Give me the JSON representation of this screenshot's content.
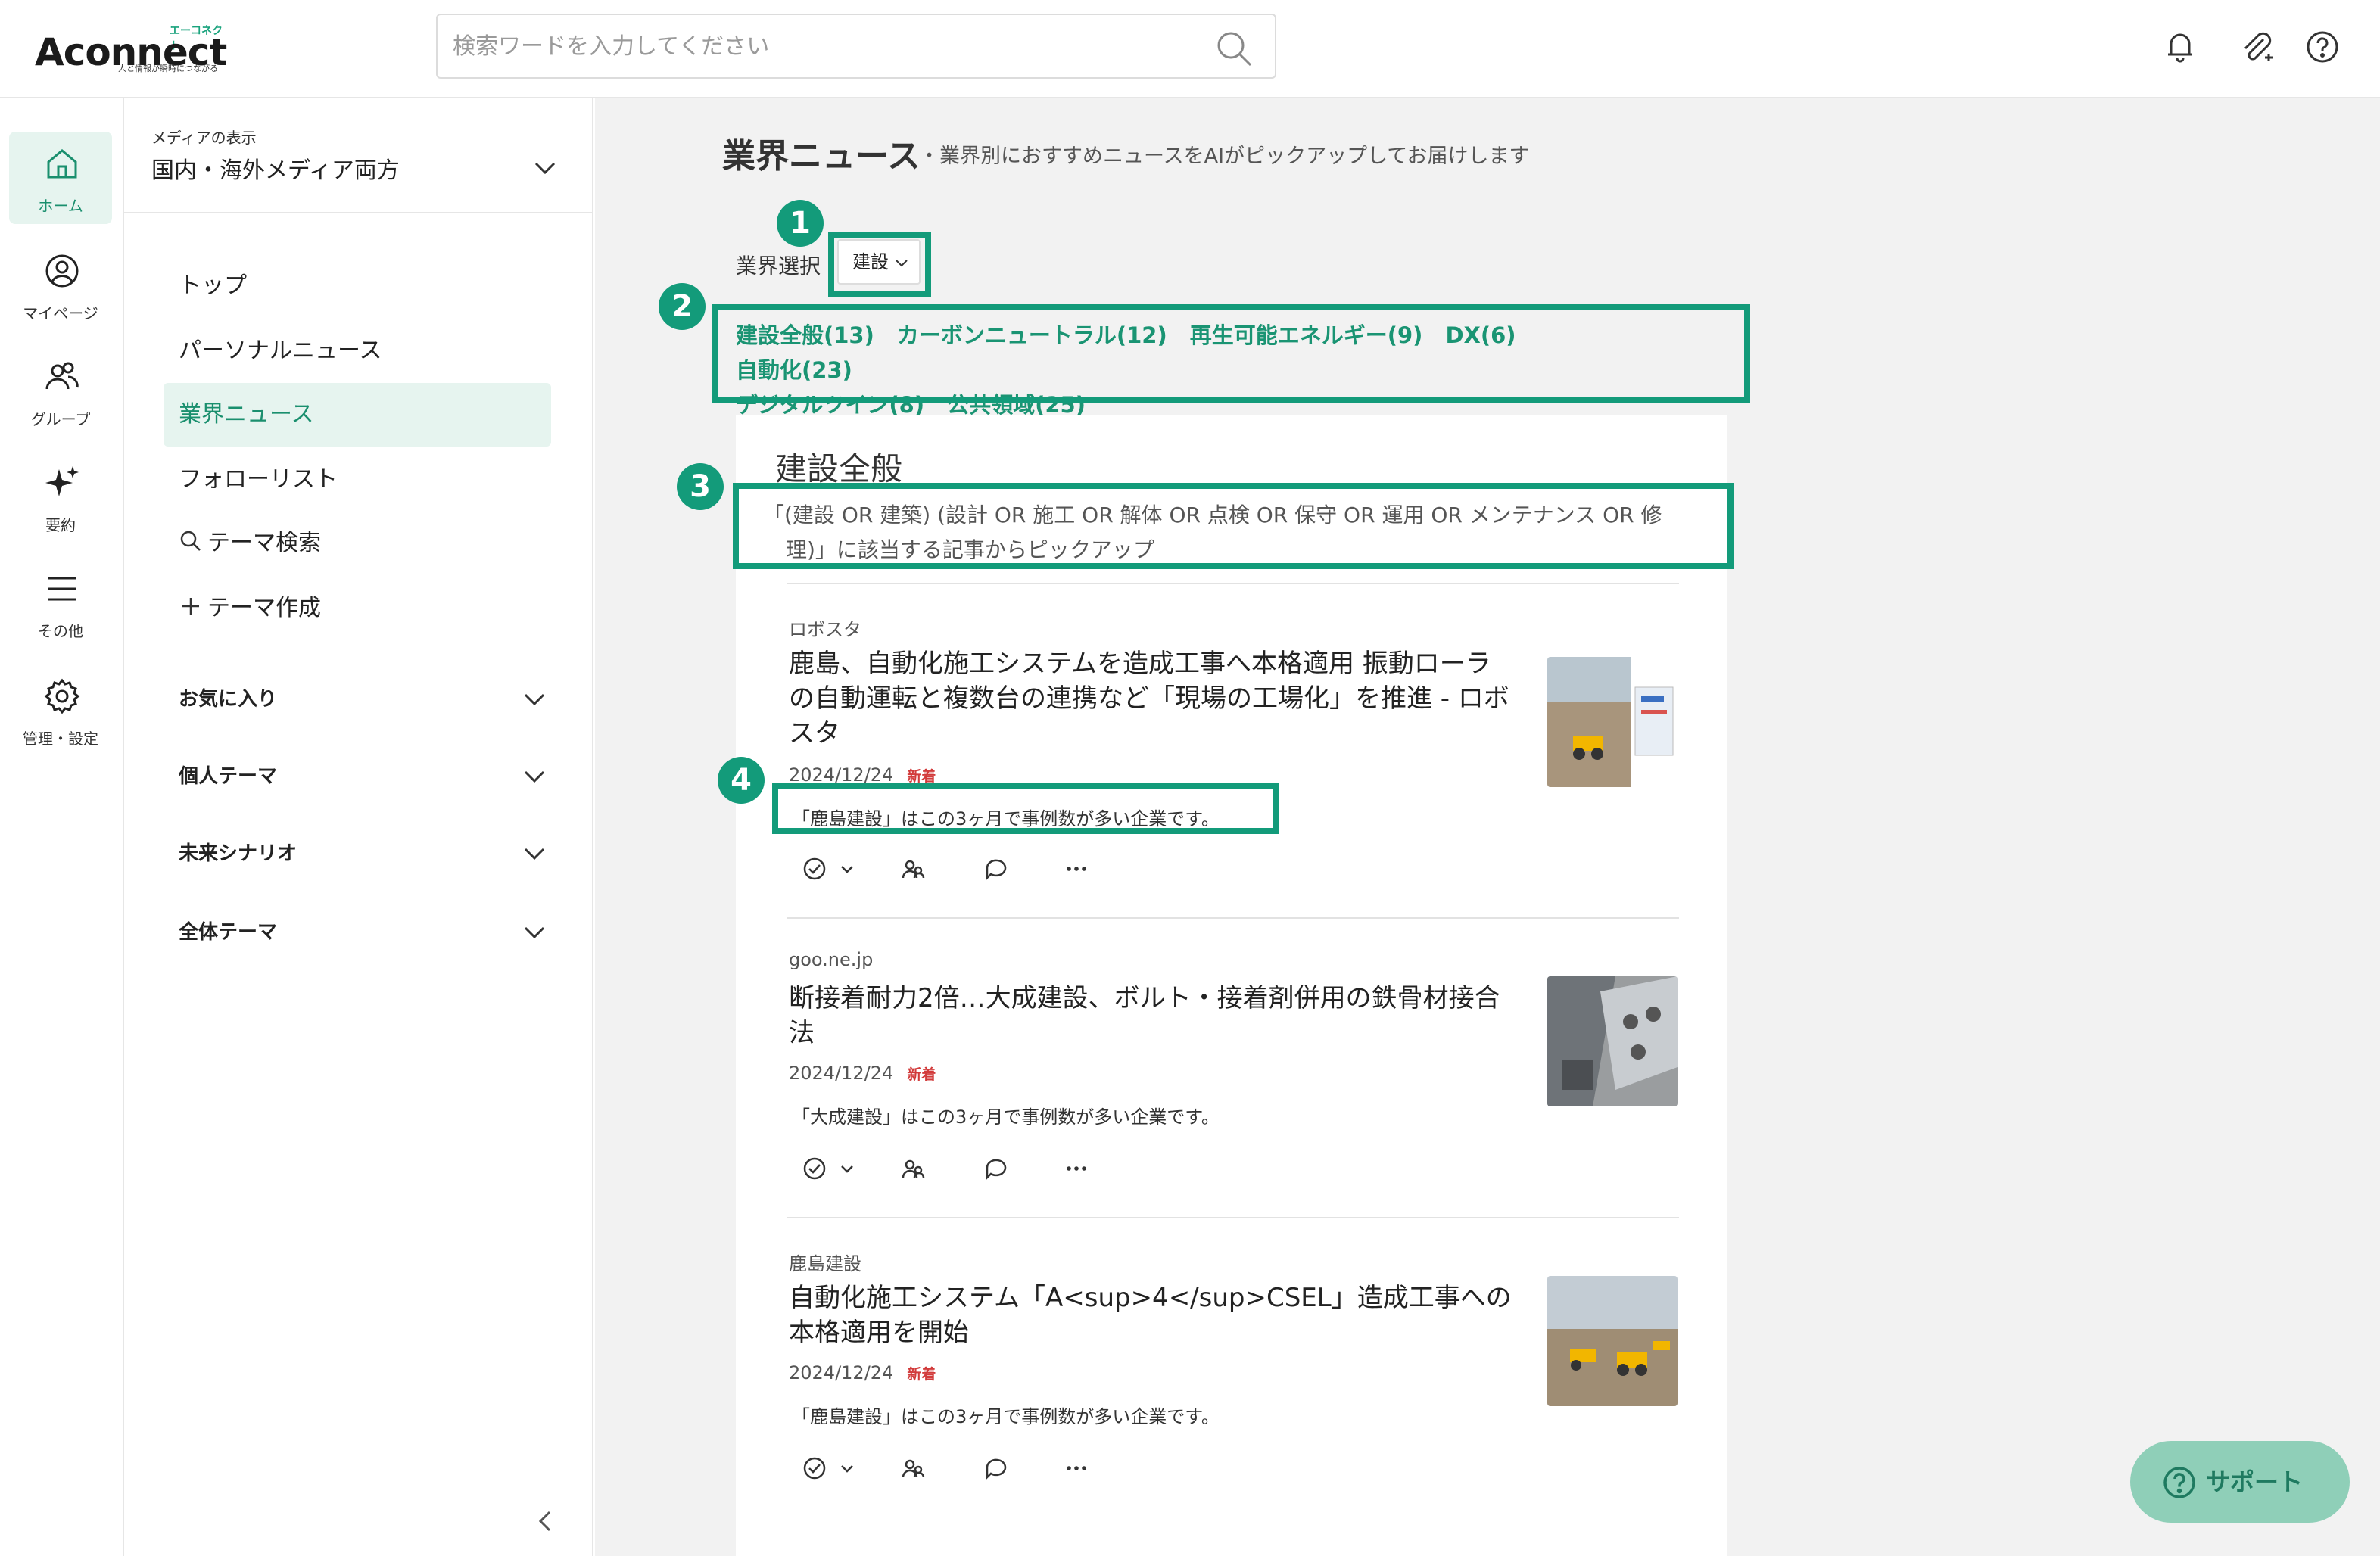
{
  "header": {
    "logo_text": "Aconnect",
    "logo_kana": "エーコネクト",
    "logo_tagline": "人と情報が瞬時につながる",
    "search_placeholder": "検索ワードを入力してください",
    "icons": [
      "bell-icon",
      "clip-icon",
      "help-icon"
    ]
  },
  "rail": {
    "items": [
      {
        "label": "ホーム",
        "icon": "home-icon",
        "active": true
      },
      {
        "label": "マイページ",
        "icon": "user-circle-icon"
      },
      {
        "label": "グループ",
        "icon": "group-icon"
      },
      {
        "label": "要約",
        "icon": "sparkle-icon"
      },
      {
        "label": "その他",
        "icon": "menu-icon"
      },
      {
        "label": "管理・設定",
        "icon": "gear-icon"
      }
    ]
  },
  "sidebar": {
    "media_caption": "メディアの表示",
    "media_value": "国内・海外メディア両方",
    "nav": [
      {
        "label": "トップ"
      },
      {
        "label": "パーソナルニュース"
      },
      {
        "label": "業界ニュース",
        "active": true
      },
      {
        "label": "フォローリスト"
      },
      {
        "label": "テーマ検索",
        "icon": "search-icon"
      },
      {
        "label": "テーマ作成",
        "icon": "plus-icon"
      }
    ],
    "accordions": [
      {
        "label": "お気に入り"
      },
      {
        "label": "個人テーマ"
      },
      {
        "label": "未来シナリオ"
      },
      {
        "label": "全体テーマ"
      }
    ]
  },
  "main": {
    "title": "業界ニュース",
    "subtitle": "・業界別におすすめニュースをAIがピックアップしてお届けします",
    "industry_label": "業界選択",
    "industry_value": "建設",
    "badges": [
      "1",
      "2",
      "3",
      "4"
    ],
    "categories": [
      "建設全般(13)",
      "カーボンニュートラル(12)",
      "再生可能エネルギー(9)",
      "DX(6)",
      "自動化(23)",
      "デジタルツイン(8)",
      "公共領域(25)"
    ],
    "section_title": "建設全般",
    "query_line1": "「(建設 OR 建築) (設計 OR 施工 OR 解体 OR 点検 OR 保守 OR 運用 OR メンテナンス OR 修",
    "query_line2": "理)」に該当する記事からピックアップ",
    "articles": [
      {
        "source": "ロボスタ",
        "title": "鹿島、自動化施工システムを造成工事へ本格適用 振動ローラの自動運転と複数台の連携など「現場の工場化」を推進 - ロボスタ",
        "date": "2024/12/24",
        "new_label": "新着",
        "note": "「鹿島建設」はこの3ヶ月で事例数が多い企業です。"
      },
      {
        "source": "goo.ne.jp",
        "title": "断接着耐力2倍…大成建設、ボルト・接着剤併用の鉄骨材接合法",
        "date": "2024/12/24",
        "new_label": "新着",
        "note": "「大成建設」はこの3ヶ月で事例数が多い企業です。"
      },
      {
        "source": "鹿島建設",
        "title": "自動化施工システム「A<sup>4</sup>CSEL」造成工事への本格適用を開始",
        "date": "2024/12/24",
        "new_label": "新着",
        "note": "「鹿島建設」はこの3ヶ月で事例数が多い企業です。"
      }
    ]
  },
  "support_label": "サポート",
  "colors": {
    "accent": "#139b7a",
    "accent_light": "#e6f4ef",
    "new_red": "#d23b3b"
  }
}
